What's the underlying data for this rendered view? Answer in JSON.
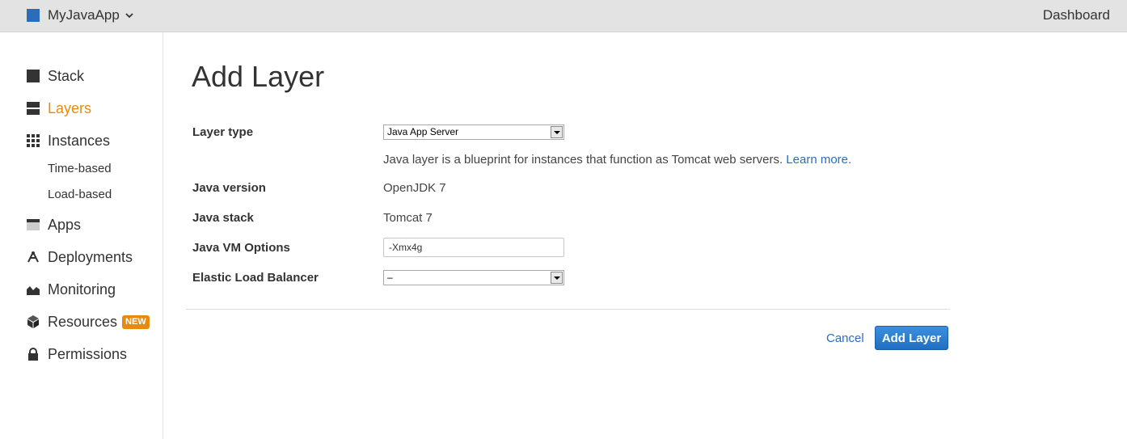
{
  "topbar": {
    "app_name": "MyJavaApp",
    "dashboard_label": "Dashboard",
    "brand_color": "#2a6ebb"
  },
  "sidebar": {
    "items": [
      {
        "label": "Stack",
        "icon": "stack-icon"
      },
      {
        "label": "Layers",
        "icon": "layers-icon",
        "active": true
      },
      {
        "label": "Instances",
        "icon": "grid-icon"
      },
      {
        "label": "Time-based"
      },
      {
        "label": "Load-based"
      },
      {
        "label": "Apps",
        "icon": "apps-icon"
      },
      {
        "label": "Deployments",
        "icon": "deployments-icon"
      },
      {
        "label": "Monitoring",
        "icon": "monitoring-icon"
      },
      {
        "label": "Resources",
        "icon": "cube-icon",
        "badge": "NEW"
      },
      {
        "label": "Permissions",
        "icon": "lock-icon"
      }
    ],
    "active_color": "#e88a10"
  },
  "main": {
    "title": "Add Layer",
    "layer_type": {
      "label": "Layer type",
      "value": "Java App Server"
    },
    "help": {
      "text": "Java layer is a blueprint for instances that function as Tomcat web servers. ",
      "link": "Learn more."
    },
    "java_version": {
      "label": "Java version",
      "value": "OpenJDK 7"
    },
    "java_stack": {
      "label": "Java stack",
      "value": "Tomcat 7"
    },
    "vm_options": {
      "label": "Java VM Options",
      "value": "-Xmx4g"
    },
    "elb": {
      "label": "Elastic Load Balancer",
      "value": "–"
    },
    "cancel_label": "Cancel",
    "submit_label": "Add Layer"
  }
}
